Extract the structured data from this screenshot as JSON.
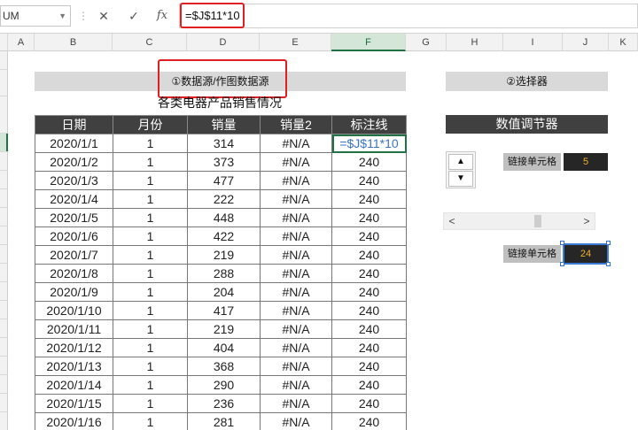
{
  "formula_bar": {
    "name_box": "UM",
    "separator": "⋮",
    "cancel_icon": "✕",
    "enter_icon": "✓",
    "fx_label": "fx",
    "formula": "=$J$11*10"
  },
  "columns": [
    "A",
    "B",
    "C",
    "D",
    "E",
    "F",
    "G",
    "H",
    "I",
    "J",
    "K"
  ],
  "selected_column": "F",
  "sheet": {
    "banner_left": "①数据源/作图数据源",
    "banner_right": "②选择器",
    "title": "各类电器产品销售情况",
    "headers": [
      "日期",
      "月份",
      "销量",
      "销量2",
      "标注线"
    ],
    "rows": [
      [
        "2020/1/1",
        "1",
        "314",
        "#N/A",
        "=$J$11*10"
      ],
      [
        "2020/1/2",
        "1",
        "373",
        "#N/A",
        "240"
      ],
      [
        "2020/1/3",
        "1",
        "477",
        "#N/A",
        "240"
      ],
      [
        "2020/1/4",
        "1",
        "222",
        "#N/A",
        "240"
      ],
      [
        "2020/1/5",
        "1",
        "448",
        "#N/A",
        "240"
      ],
      [
        "2020/1/6",
        "1",
        "422",
        "#N/A",
        "240"
      ],
      [
        "2020/1/7",
        "1",
        "219",
        "#N/A",
        "240"
      ],
      [
        "2020/1/8",
        "1",
        "288",
        "#N/A",
        "240"
      ],
      [
        "2020/1/9",
        "1",
        "204",
        "#N/A",
        "240"
      ],
      [
        "2020/1/10",
        "1",
        "417",
        "#N/A",
        "240"
      ],
      [
        "2020/1/11",
        "1",
        "219",
        "#N/A",
        "240"
      ],
      [
        "2020/1/12",
        "1",
        "404",
        "#N/A",
        "240"
      ],
      [
        "2020/1/13",
        "1",
        "368",
        "#N/A",
        "240"
      ],
      [
        "2020/1/14",
        "1",
        "290",
        "#N/A",
        "240"
      ],
      [
        "2020/1/15",
        "1",
        "236",
        "#N/A",
        "240"
      ],
      [
        "2020/1/16",
        "1",
        "281",
        "#N/A",
        "240"
      ]
    ]
  },
  "controls": {
    "header": "数值调节器",
    "spin_up": "▲",
    "spin_down": "▼",
    "link_label_1": "链接单元格",
    "link_value_1": "5",
    "scroll_left": "<",
    "scroll_right": ">",
    "link_label_2": "链接单元格",
    "link_value_2": "24"
  },
  "colors": {
    "header_dark": "#404040",
    "banner_gray": "#d9d9d9",
    "highlight_red": "#e02020",
    "selection_green": "#217346",
    "value_gold": "#f0b429"
  }
}
